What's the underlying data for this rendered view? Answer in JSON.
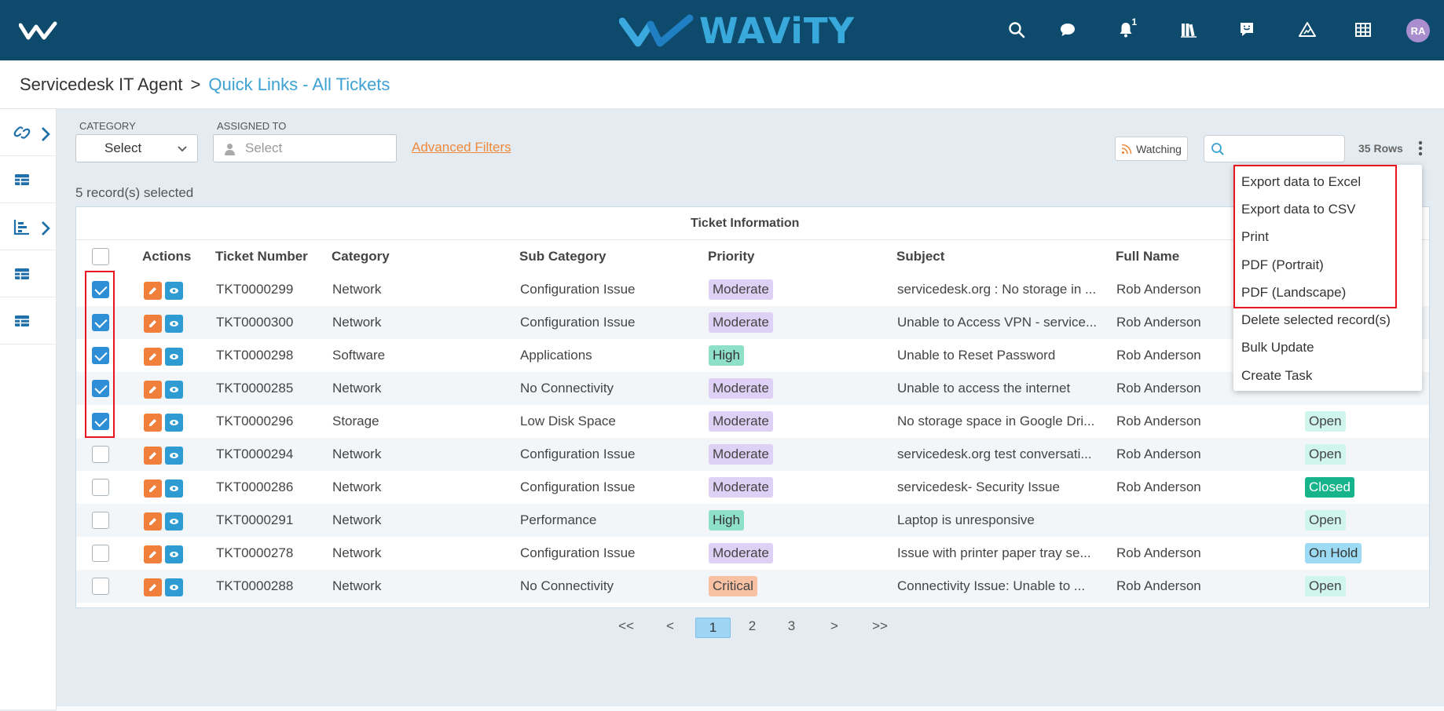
{
  "header": {
    "brand": "WAViTY",
    "notification_count": "1",
    "avatar_initials": "RA",
    "icons": [
      "search-icon",
      "chat-icon",
      "bell-icon",
      "library-icon",
      "feedback-icon",
      "warning-icon",
      "grid-icon"
    ]
  },
  "breadcrumb": {
    "root": "Servicedesk IT Agent",
    "separator": ">",
    "current": "Quick Links - All Tickets"
  },
  "filters": {
    "category_label": "CATEGORY",
    "category_value": "Select",
    "assigned_label": "ASSIGNED TO",
    "assigned_placeholder": "Select",
    "advanced": "Advanced Filters",
    "watching": "Watching",
    "search_placeholder": "",
    "rows": "35 Rows"
  },
  "selection": "5 record(s) selected",
  "table": {
    "group_header": "Ticket Information",
    "columns": [
      "Actions",
      "Ticket Number",
      "Category",
      "Sub Category",
      "Priority",
      "Subject",
      "Full Name"
    ],
    "rows": [
      {
        "checked": true,
        "ticket": "TKT0000299",
        "category": "Network",
        "sub": "Configuration Issue",
        "priority": "Moderate",
        "subject": "servicedesk.org : No storage in ...",
        "name": "Rob Anderson",
        "status": ""
      },
      {
        "checked": true,
        "ticket": "TKT0000300",
        "category": "Network",
        "sub": "Configuration Issue",
        "priority": "Moderate",
        "subject": "Unable to Access VPN - service...",
        "name": "Rob Anderson",
        "status": ""
      },
      {
        "checked": true,
        "ticket": "TKT0000298",
        "category": "Software",
        "sub": "Applications",
        "priority": "High",
        "subject": "Unable to Reset Password",
        "name": "Rob Anderson",
        "status": ""
      },
      {
        "checked": true,
        "ticket": "TKT0000285",
        "category": "Network",
        "sub": "No Connectivity",
        "priority": "Moderate",
        "subject": "Unable to access the internet",
        "name": "Rob Anderson",
        "status": ""
      },
      {
        "checked": true,
        "ticket": "TKT0000296",
        "category": "Storage",
        "sub": "Low Disk Space",
        "priority": "Moderate",
        "subject": "No storage space in Google Dri...",
        "name": "Rob Anderson",
        "status": "Open"
      },
      {
        "checked": false,
        "ticket": "TKT0000294",
        "category": "Network",
        "sub": "Configuration Issue",
        "priority": "Moderate",
        "subject": "servicedesk.org test conversati...",
        "name": "Rob Anderson",
        "status": "Open"
      },
      {
        "checked": false,
        "ticket": "TKT0000286",
        "category": "Network",
        "sub": "Configuration Issue",
        "priority": "Moderate",
        "subject": "servicedesk- Security Issue",
        "name": "Rob Anderson",
        "status": "Closed"
      },
      {
        "checked": false,
        "ticket": "TKT0000291",
        "category": "Network",
        "sub": "Performance",
        "priority": "High",
        "subject": "Laptop is unresponsive",
        "name": "",
        "status": "Open"
      },
      {
        "checked": false,
        "ticket": "TKT0000278",
        "category": "Network",
        "sub": "Configuration Issue",
        "priority": "Moderate",
        "subject": "Issue with printer paper tray se...",
        "name": "Rob Anderson",
        "status": "On Hold"
      },
      {
        "checked": false,
        "ticket": "TKT0000288",
        "category": "Network",
        "sub": "No Connectivity",
        "priority": "Critical",
        "subject": "Connectivity Issue: Unable to ...",
        "name": "Rob Anderson",
        "status": "Open"
      }
    ]
  },
  "pagination": {
    "first": "<<",
    "prev": "<",
    "pages": [
      "1",
      "2",
      "3"
    ],
    "next": ">",
    "last": ">>",
    "active": "1"
  },
  "menu": {
    "items": [
      "Export data to Excel",
      "Export data to CSV",
      "Print",
      "PDF (Portrait)",
      "PDF (Landscape)",
      "Delete selected record(s)",
      "Bulk Update",
      "Create Task"
    ]
  },
  "colors": {
    "header_bg": "#0d4a6c",
    "accent": "#3da1d3",
    "highlight": "#e8141f"
  }
}
